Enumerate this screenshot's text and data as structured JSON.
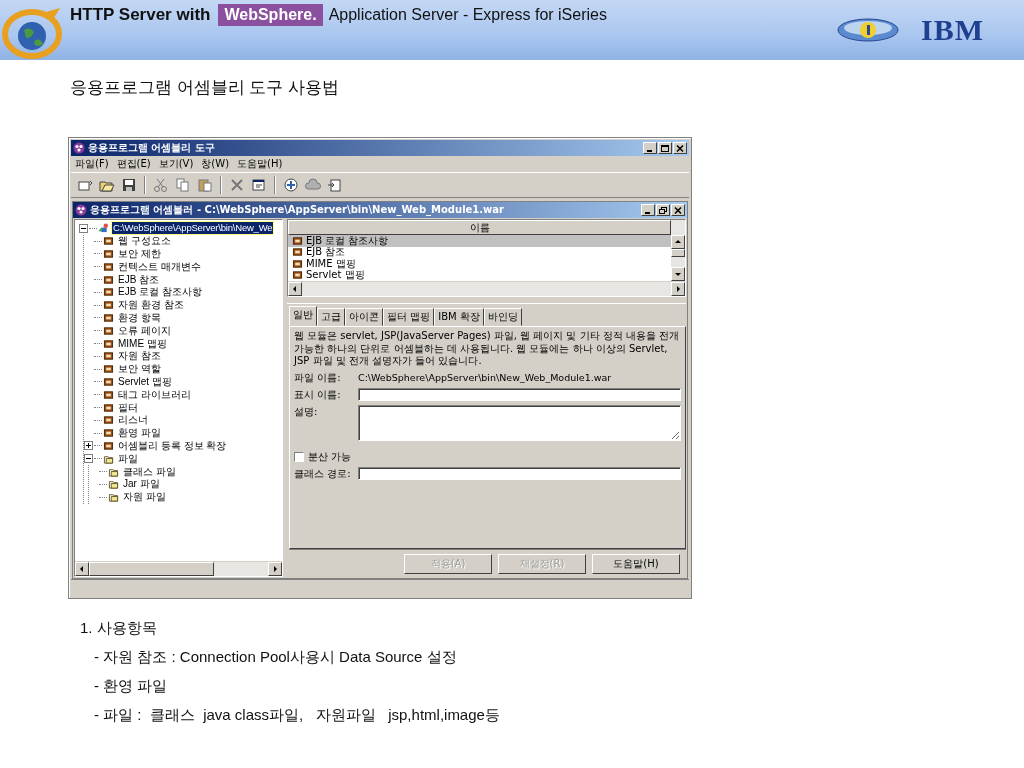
{
  "header": {
    "title": "HTTP Server with",
    "brand": "WebSphere.",
    "subtitle": "Application Server - Express for iSeries",
    "logo": "IBM"
  },
  "slide_title": "응용프로그램 어셈블리 도구 사용법",
  "window": {
    "title": "응용프로그램 어셈블리 도구",
    "menu": [
      "파일(F)",
      "편집(E)",
      "보기(V)",
      "창(W)",
      "도움말(H)"
    ],
    "document": {
      "title": "응용프로그램 어셈블러 - C:\\WebSphere\\AppServer\\bin\\New_Web_Module1.war",
      "tree": {
        "label": "C:\\WebSphere\\AppServer\\bin\\New_We",
        "kind": "module",
        "selected": true,
        "expanded": true,
        "children": [
          {
            "label": "웹 구성요소",
            "kind": "item",
            "selected": false
          },
          {
            "label": "보안 제한",
            "kind": "item",
            "selected": false
          },
          {
            "label": "컨텍스트 매개변수",
            "kind": "item",
            "selected": false
          },
          {
            "label": "EJB 참조",
            "kind": "item",
            "selected": false
          },
          {
            "label": "EJB 로컬 참조사항",
            "kind": "item",
            "selected": false
          },
          {
            "label": "자원 환경 참조",
            "kind": "item",
            "selected": false
          },
          {
            "label": "환경 항목",
            "kind": "item",
            "selected": false
          },
          {
            "label": "오류 페이지",
            "kind": "item",
            "selected": false
          },
          {
            "label": "MIME 맵핑",
            "kind": "item",
            "selected": false
          },
          {
            "label": "자원 참조",
            "kind": "item",
            "selected": false
          },
          {
            "label": "보안 역할",
            "kind": "item",
            "selected": false
          },
          {
            "label": "Servlet 맵핑",
            "kind": "item",
            "selected": false
          },
          {
            "label": "태그 라이브러리",
            "kind": "item",
            "selected": false
          },
          {
            "label": "필터",
            "kind": "item",
            "selected": false
          },
          {
            "label": "리스너",
            "kind": "item",
            "selected": false
          },
          {
            "label": "환영 파일",
            "kind": "item",
            "selected": false
          },
          {
            "label": "어셈블리 등록 정보 확장",
            "kind": "item",
            "selected": false,
            "expanded": false
          },
          {
            "label": "파일",
            "kind": "folder",
            "selected": false,
            "expanded": true,
            "children": [
              {
                "label": "클래스 파일",
                "kind": "folder",
                "selected": false
              },
              {
                "label": "Jar 파일",
                "kind": "folder",
                "selected": false
              },
              {
                "label": "자원 파일",
                "kind": "folder",
                "selected": false
              }
            ]
          }
        ]
      },
      "list": {
        "column": "이름",
        "rows": [
          {
            "label": "EJB 로컬 참조사항",
            "selected": true
          },
          {
            "label": "EJB 참조",
            "selected": false
          },
          {
            "label": "MIME 맵핑",
            "selected": false
          },
          {
            "label": "Servlet 맵핑",
            "selected": false
          }
        ]
      },
      "tabs": [
        {
          "label": "일반",
          "selected": true
        },
        {
          "label": "고급",
          "selected": false
        },
        {
          "label": "아이콘",
          "selected": false
        },
        {
          "label": "필터 맵핑",
          "selected": false
        },
        {
          "label": "IBM 확장",
          "selected": false
        },
        {
          "label": "바인딩",
          "selected": false
        }
      ],
      "description": "웹 모듈은 servlet, JSP(JavaServer Pages) 파일, 웹 페이지 및 기타 정적 내용을 전개 가능한 하나의 단위로 어셈블하는 데 사용됩니다. 웹 모듈에는 하나 이상의 Servlet, JSP 파일 및 전개 설명자가 들어 있습니다.",
      "file_name": {
        "label": "파일 이름:",
        "value": "C:\\WebSphere\\AppServer\\bin\\New_Web_Module1.war"
      },
      "display_name": {
        "label": "표시 이름:"
      },
      "description_field": {
        "label": "설명:"
      },
      "distributable": {
        "label": "분산 가능",
        "checked": false
      },
      "class_path": {
        "label": "클래스 경로:"
      },
      "buttons": [
        {
          "label": "적용(A)",
          "disabled": true
        },
        {
          "label": "재설정(R)",
          "disabled": true
        },
        {
          "label": "도움말(H)",
          "disabled": false
        }
      ]
    }
  },
  "notes": {
    "heading": "1. 사용항목",
    "items": [
      "- 자원 참조 : Connection Pool사용시 Data Source 설정",
      "- 환영 파일",
      "- 파일 :  클래스  java class파일,   자원파일   jsp,html,image등"
    ]
  }
}
